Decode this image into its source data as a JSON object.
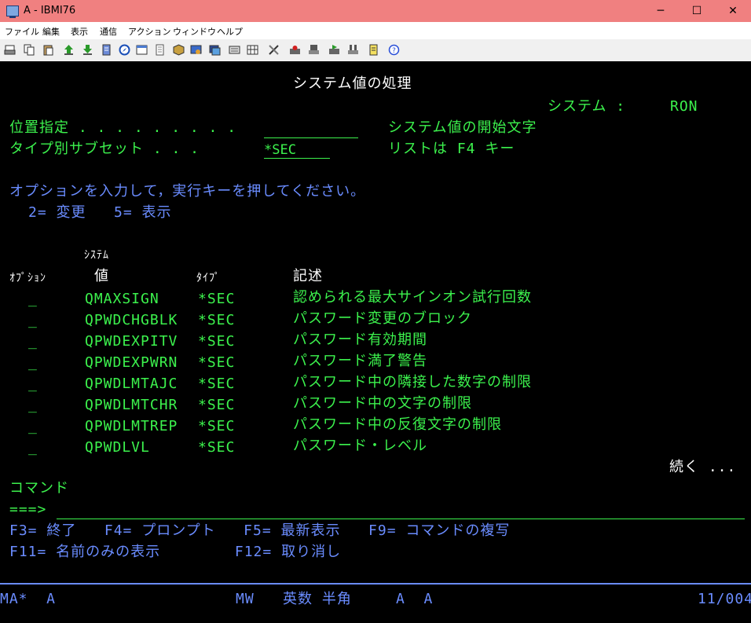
{
  "window": {
    "title": "A - IBMI76",
    "minimize": "─",
    "maximize": "☐",
    "close": "✕"
  },
  "menu": [
    "ファイル",
    "編集",
    "表示",
    "通信",
    "アクション",
    "ウィンドウ",
    "ヘルプ"
  ],
  "screen": {
    "title": "システム値の処理",
    "system_label": "システム :",
    "system_value": "RON",
    "position_label": "位置指定 . . . . . . . . .",
    "position_value": "",
    "position_hint": "システム値の開始文字",
    "subset_label": "タイプ別サブセット . . .",
    "subset_value": "*SEC",
    "subset_hint": "リストは F4 キー",
    "instruction": "オプションを入力して，実行キーを押してください。",
    "options_line": "2= 変更   5= 表示",
    "col_header_system": "ｼｽﾃﾑ",
    "col_header_option": "ｵﾌﾟｼｮﾝ",
    "col_header_value": "値",
    "col_header_type": "ﾀｲﾌﾟ",
    "col_header_desc": "記述",
    "rows": [
      {
        "option": "_",
        "name": "QMAXSIGN",
        "type": "*SEC",
        "desc": "認められる最大サインオン試行回数"
      },
      {
        "option": "_",
        "name": "QPWDCHGBLK",
        "type": "*SEC",
        "desc": "パスワード変更のブロック"
      },
      {
        "option": "_",
        "name": "QPWDEXPITV",
        "type": "*SEC",
        "desc": "パスワード有効期間"
      },
      {
        "option": "_",
        "name": "QPWDEXPWRN",
        "type": "*SEC",
        "desc": "パスワード満了警告"
      },
      {
        "option": "_",
        "name": "QPWDLMTAJC",
        "type": "*SEC",
        "desc": "パスワード中の隣接した数字の制限"
      },
      {
        "option": "_",
        "name": "QPWDLMTCHR",
        "type": "*SEC",
        "desc": "パスワード中の文字の制限"
      },
      {
        "option": "_",
        "name": "QPWDLMTREP",
        "type": "*SEC",
        "desc": "パスワード中の反復文字の制限"
      },
      {
        "option": "_",
        "name": "QPWDLVL",
        "type": "*SEC",
        "desc": "パスワード・レベル"
      }
    ],
    "more": "続く ...",
    "command_label": "コマンド",
    "prompt": "===>",
    "command_value": "",
    "fkeys_line1": "F3= 終了   F4= プロンプト   F5= 最新表示   F9= コマンドの複写",
    "fkeys_line2": "F11= 名前のみの表示        F12= 取り消し"
  },
  "status_bar": {
    "left": "MA*  A",
    "mode": "MW",
    "input_mode": "英数 半角",
    "shift": "A  A",
    "position": "11/004"
  },
  "colors": {
    "titlebar": "#f08080",
    "green": "#3cf24d",
    "blue": "#6a8cff",
    "white": "#ffffff",
    "background": "#000000"
  }
}
